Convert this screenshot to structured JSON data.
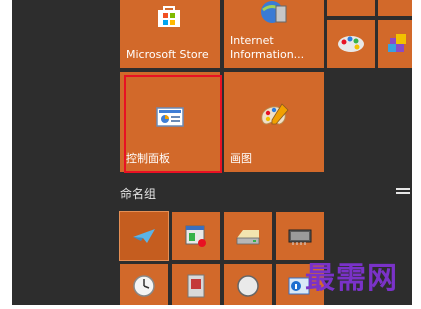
{
  "accent": "#d2692a",
  "outline": "#e81123",
  "tiles": {
    "microsoft_store": "Microsoft Store",
    "internet_information": "Internet\nInformation...",
    "control_panel": "控制面板",
    "paint": "画图"
  },
  "group": {
    "title": "命名组"
  },
  "watermark": "最需网"
}
